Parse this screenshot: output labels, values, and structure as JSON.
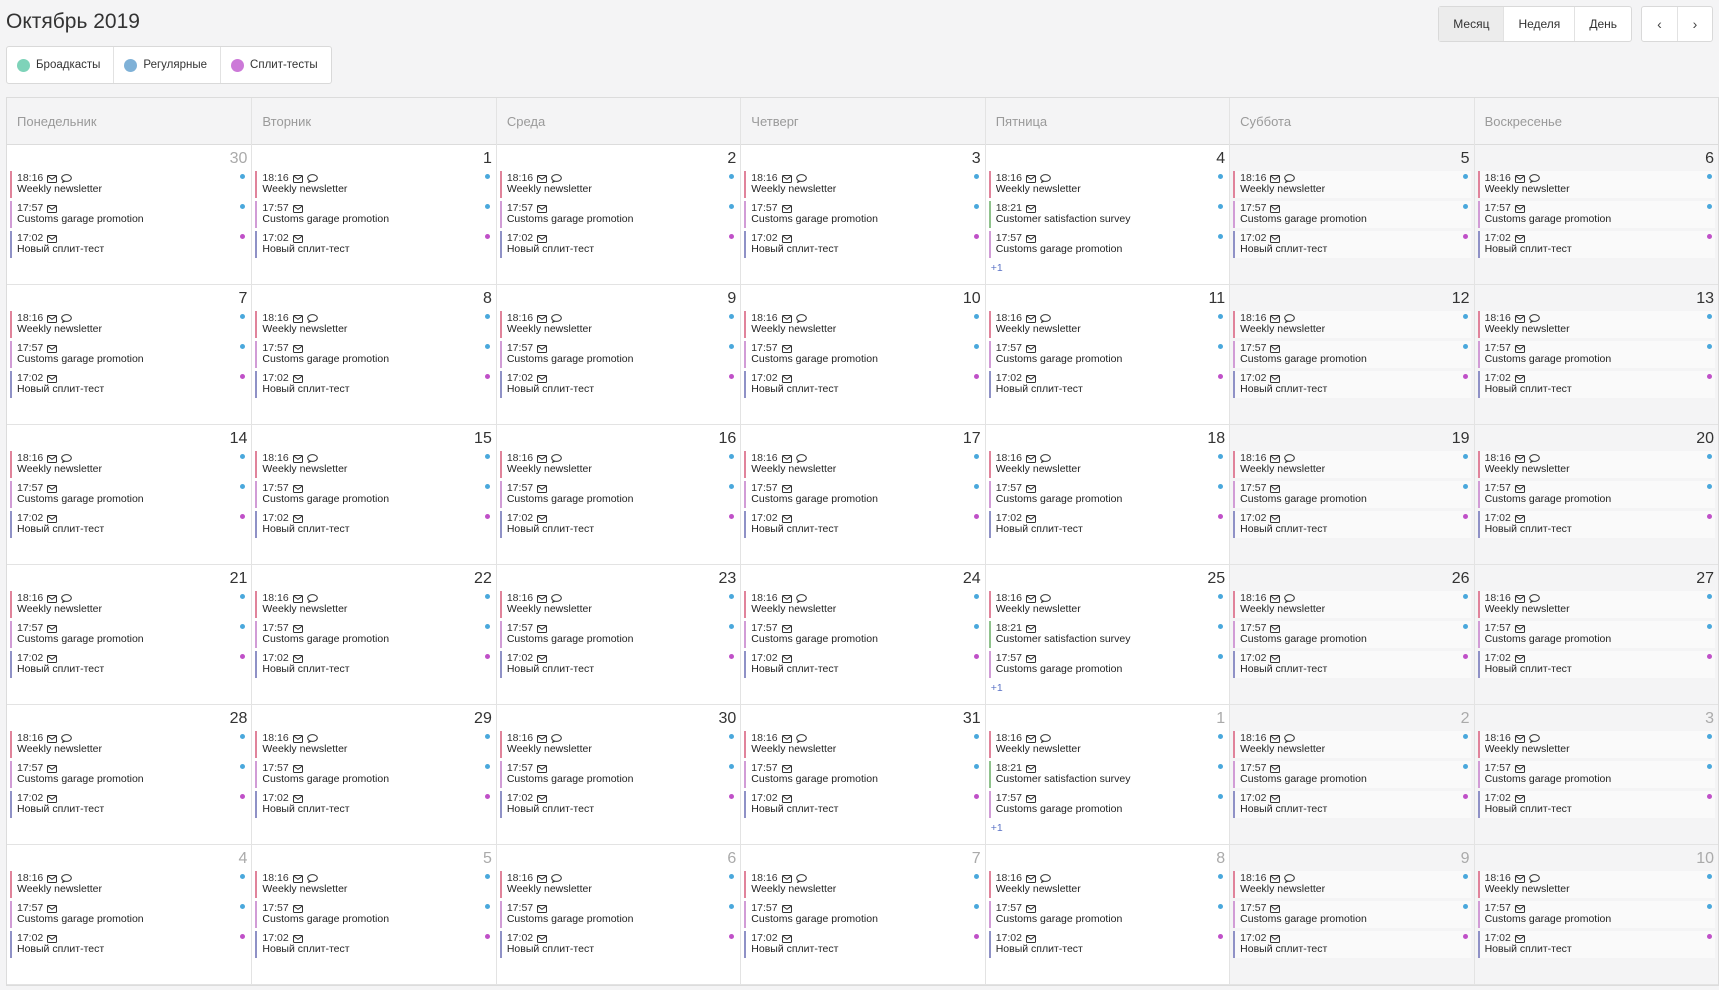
{
  "header": {
    "title": "Октябрь 2019"
  },
  "views": [
    {
      "key": "month",
      "label": "Месяц"
    },
    {
      "key": "week",
      "label": "Неделя"
    },
    {
      "key": "day",
      "label": "День"
    }
  ],
  "nav": {
    "prev_icon": "chevron-left-icon",
    "next_icon": "chevron-right-icon",
    "prev_glyph": "‹",
    "next_glyph": "›"
  },
  "legend": [
    {
      "label": "Броадкасты",
      "color": "#7ed3b9"
    },
    {
      "label": "Регулярные",
      "color": "#7fb1d7"
    },
    {
      "label": "Сплит-тесты",
      "color": "#cc79d8"
    }
  ],
  "weekdays": [
    "Понедельник",
    "Вторник",
    "Среда",
    "Четверг",
    "Пятница",
    "Суббота",
    "Воскресенье"
  ],
  "colors": {
    "weekly": "#e0839b",
    "regular_bar": "#d19cd6",
    "split_bar": "#8f91c6",
    "survey_bar": "#8fc28c",
    "dot_regular": "#4aa8dc",
    "dot_split": "#c050c8"
  },
  "event_templates": {
    "weekly": {
      "time": "18:16",
      "name": "Weekly newsletter",
      "icons": [
        "envelope-icon",
        "chat-bubble-icon"
      ],
      "bar": "#e0839b",
      "dot": "#4aa8dc"
    },
    "promo": {
      "time": "17:57",
      "name": "Customs garage promotion",
      "icons": [
        "envelope-icon"
      ],
      "bar": "#d19cd6",
      "dot": "#4aa8dc"
    },
    "split": {
      "time": "17:02",
      "name": "Новый сплит-тест",
      "icons": [
        "envelope-icon"
      ],
      "bar": "#8f91c6",
      "dot": "#c050c8"
    },
    "survey": {
      "time": "18:21",
      "name": "Customer satisfaction survey",
      "icons": [
        "envelope-icon"
      ],
      "bar": "#8fc28c",
      "dot": "#4aa8dc"
    }
  },
  "weeks": [
    [
      {
        "day": "30",
        "other": true,
        "events": [
          "weekly",
          "promo",
          "split"
        ]
      },
      {
        "day": "1",
        "events": [
          "weekly",
          "promo",
          "split"
        ]
      },
      {
        "day": "2",
        "events": [
          "weekly",
          "promo",
          "split"
        ]
      },
      {
        "day": "3",
        "events": [
          "weekly",
          "promo",
          "split"
        ]
      },
      {
        "day": "4",
        "events": [
          "weekly",
          "survey",
          "promo"
        ],
        "more": "+1"
      },
      {
        "day": "5",
        "weekend": true,
        "events": [
          "weekly",
          "promo",
          "split"
        ]
      },
      {
        "day": "6",
        "weekend": true,
        "events": [
          "weekly",
          "promo",
          "split"
        ]
      }
    ],
    [
      {
        "day": "7",
        "events": [
          "weekly",
          "promo",
          "split"
        ]
      },
      {
        "day": "8",
        "events": [
          "weekly",
          "promo",
          "split"
        ]
      },
      {
        "day": "9",
        "events": [
          "weekly",
          "promo",
          "split"
        ]
      },
      {
        "day": "10",
        "events": [
          "weekly",
          "promo",
          "split"
        ]
      },
      {
        "day": "11",
        "events": [
          "weekly",
          "promo",
          "split"
        ]
      },
      {
        "day": "12",
        "weekend": true,
        "events": [
          "weekly",
          "promo",
          "split"
        ]
      },
      {
        "day": "13",
        "weekend": true,
        "events": [
          "weekly",
          "promo",
          "split"
        ]
      }
    ],
    [
      {
        "day": "14",
        "events": [
          "weekly",
          "promo",
          "split"
        ]
      },
      {
        "day": "15",
        "events": [
          "weekly",
          "promo",
          "split"
        ]
      },
      {
        "day": "16",
        "events": [
          "weekly",
          "promo",
          "split"
        ]
      },
      {
        "day": "17",
        "events": [
          "weekly",
          "promo",
          "split"
        ]
      },
      {
        "day": "18",
        "events": [
          "weekly",
          "promo",
          "split"
        ]
      },
      {
        "day": "19",
        "weekend": true,
        "events": [
          "weekly",
          "promo",
          "split"
        ]
      },
      {
        "day": "20",
        "weekend": true,
        "events": [
          "weekly",
          "promo",
          "split"
        ]
      }
    ],
    [
      {
        "day": "21",
        "events": [
          "weekly",
          "promo",
          "split"
        ]
      },
      {
        "day": "22",
        "events": [
          "weekly",
          "promo",
          "split"
        ]
      },
      {
        "day": "23",
        "events": [
          "weekly",
          "promo",
          "split"
        ]
      },
      {
        "day": "24",
        "events": [
          "weekly",
          "promo",
          "split"
        ]
      },
      {
        "day": "25",
        "events": [
          "weekly",
          "survey",
          "promo"
        ],
        "more": "+1"
      },
      {
        "day": "26",
        "weekend": true,
        "events": [
          "weekly",
          "promo",
          "split"
        ]
      },
      {
        "day": "27",
        "weekend": true,
        "events": [
          "weekly",
          "promo",
          "split"
        ]
      }
    ],
    [
      {
        "day": "28",
        "events": [
          "weekly",
          "promo",
          "split"
        ]
      },
      {
        "day": "29",
        "events": [
          "weekly",
          "promo",
          "split"
        ]
      },
      {
        "day": "30",
        "events": [
          "weekly",
          "promo",
          "split"
        ]
      },
      {
        "day": "31",
        "events": [
          "weekly",
          "promo",
          "split"
        ]
      },
      {
        "day": "1",
        "other": true,
        "events": [
          "weekly",
          "survey",
          "promo"
        ],
        "more": "+1"
      },
      {
        "day": "2",
        "other": true,
        "weekend": true,
        "events": [
          "weekly",
          "promo",
          "split"
        ]
      },
      {
        "day": "3",
        "other": true,
        "weekend": true,
        "events": [
          "weekly",
          "promo",
          "split"
        ]
      }
    ],
    [
      {
        "day": "4",
        "other": true,
        "events": [
          "weekly",
          "promo",
          "split"
        ]
      },
      {
        "day": "5",
        "other": true,
        "events": [
          "weekly",
          "promo",
          "split"
        ]
      },
      {
        "day": "6",
        "other": true,
        "events": [
          "weekly",
          "promo",
          "split"
        ]
      },
      {
        "day": "7",
        "other": true,
        "events": [
          "weekly",
          "promo",
          "split"
        ]
      },
      {
        "day": "8",
        "other": true,
        "events": [
          "weekly",
          "promo",
          "split"
        ]
      },
      {
        "day": "9",
        "other": true,
        "weekend": true,
        "events": [
          "weekly",
          "promo",
          "split"
        ]
      },
      {
        "day": "10",
        "other": true,
        "weekend": true,
        "events": [
          "weekly",
          "promo",
          "split"
        ]
      }
    ]
  ]
}
